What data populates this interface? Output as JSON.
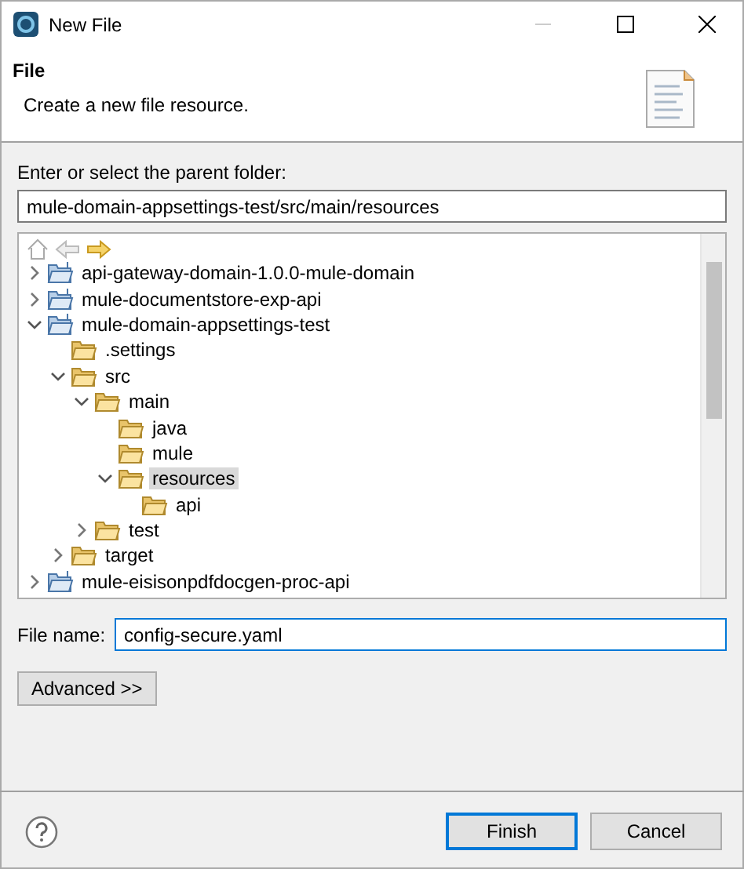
{
  "window": {
    "title": "New File"
  },
  "header": {
    "title": "File",
    "description": "Create a new file resource."
  },
  "folder_label": "Enter or select the parent folder:",
  "folder_path": "mule-domain-appsettings-test/src/main/resources",
  "tree": [
    {
      "label": "api-gateway-domain-1.0.0-mule-domain",
      "kind": "project",
      "expanded": false,
      "selected": false
    },
    {
      "label": "mule-documentstore-exp-api",
      "kind": "project",
      "expanded": false,
      "selected": false
    },
    {
      "label": "mule-domain-appsettings-test",
      "kind": "project",
      "expanded": true,
      "selected": false,
      "children": [
        {
          "label": ".settings",
          "kind": "folder",
          "selected": false
        },
        {
          "label": "src",
          "kind": "folder",
          "expanded": true,
          "selected": false,
          "children": [
            {
              "label": "main",
              "kind": "folder",
              "expanded": true,
              "selected": false,
              "children": [
                {
                  "label": "java",
                  "kind": "folder",
                  "selected": false
                },
                {
                  "label": "mule",
                  "kind": "folder",
                  "selected": false
                },
                {
                  "label": "resources",
                  "kind": "folder",
                  "expanded": true,
                  "selected": true,
                  "children": [
                    {
                      "label": "api",
                      "kind": "folder",
                      "selected": false
                    }
                  ]
                }
              ]
            },
            {
              "label": "test",
              "kind": "folder",
              "expanded": false,
              "selected": false
            }
          ]
        },
        {
          "label": "target",
          "kind": "folder",
          "expanded": false,
          "selected": false
        }
      ]
    },
    {
      "label": "mule-eisisonpdfdocgen-proc-api",
      "kind": "project",
      "expanded": false,
      "selected": false
    }
  ],
  "file_name": {
    "label": "File name:",
    "value": "config-secure.yaml"
  },
  "advanced_button": "Advanced >>",
  "buttons": [
    {
      "label": "Finish",
      "default": true
    },
    {
      "label": "Cancel",
      "default": false
    }
  ]
}
